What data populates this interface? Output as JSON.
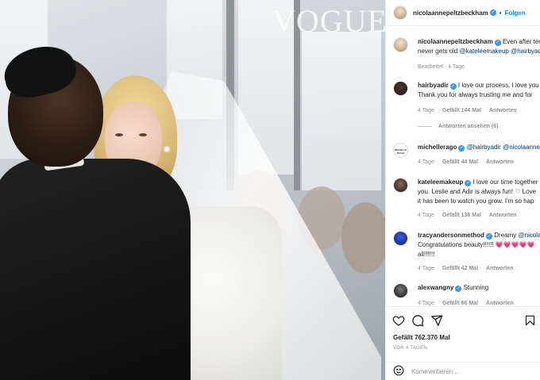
{
  "photo": {
    "watermark": "VOGUE"
  },
  "header": {
    "username": "nicolaannepeltzbeckham",
    "follow_label": "Folgen"
  },
  "caption": {
    "username": "nicolaannepeltzbeckham",
    "text": "Even after ten ",
    "line2": "never gets old ",
    "mention1": "@kateleemakeup",
    "mention2": "@hairbyadi",
    "meta": "Bearbeitet · 4 Tage"
  },
  "comments": [
    {
      "username": "hairbyadir",
      "line1": "I love our process, I love you",
      "line2": "Thank you for always trusting me and for",
      "time": "4 Tage",
      "likes": "Gefällt 144 Mal",
      "reply": "Antworten",
      "view_replies": "Antworten ansehen (6)",
      "avatar_text": ""
    },
    {
      "username": "michellerago",
      "mention1": "@hairbyadir",
      "mention2": "@nicolaanne",
      "time": "4 Tage",
      "likes": "Gefällt 44 Mal",
      "reply": "Antworten",
      "avatar_text": "MICHELLE RAGO"
    },
    {
      "username": "kateleemakeup",
      "line1": "I love our time together",
      "line2": "you. Leslie and Adir is always fun! ♡ Love",
      "line3": "it has been to watch you grow. I'm so hap",
      "time": "4 Tage",
      "likes": "Gefällt 136 Mal",
      "reply": "Antworten"
    },
    {
      "username": "tracyandersonmethod",
      "line1": "Dreamy ",
      "mention1": "@nicola",
      "line2": "Congratulations beauty!!!!!! ",
      "hearts": "💗💗💗💗💗",
      "line3": "all!!!!!!",
      "time": "4 Tage",
      "likes": "Gefällt 42 Mal",
      "reply": "Antworten"
    },
    {
      "username": "alexwangny",
      "line1": "Stunning",
      "time": "4 Tage",
      "likes": "Gefällt 66 Mal",
      "reply": "Antworten"
    }
  ],
  "actions": {
    "likes": "Gefällt 762.370 Mal",
    "posted": "VOR 4 TAGEN"
  },
  "add_comment": {
    "placeholder": "Kommentieren ..."
  },
  "icons": {
    "like": "heart-icon",
    "comment": "comment-icon",
    "share": "share-icon",
    "save": "bookmark-icon",
    "emoji": "emoji-icon",
    "verified": "verified-badge-icon"
  },
  "colors": {
    "link": "#0095f6",
    "verified": "#3897f0",
    "mention": "#00376b",
    "muted": "#8e8e8e"
  }
}
